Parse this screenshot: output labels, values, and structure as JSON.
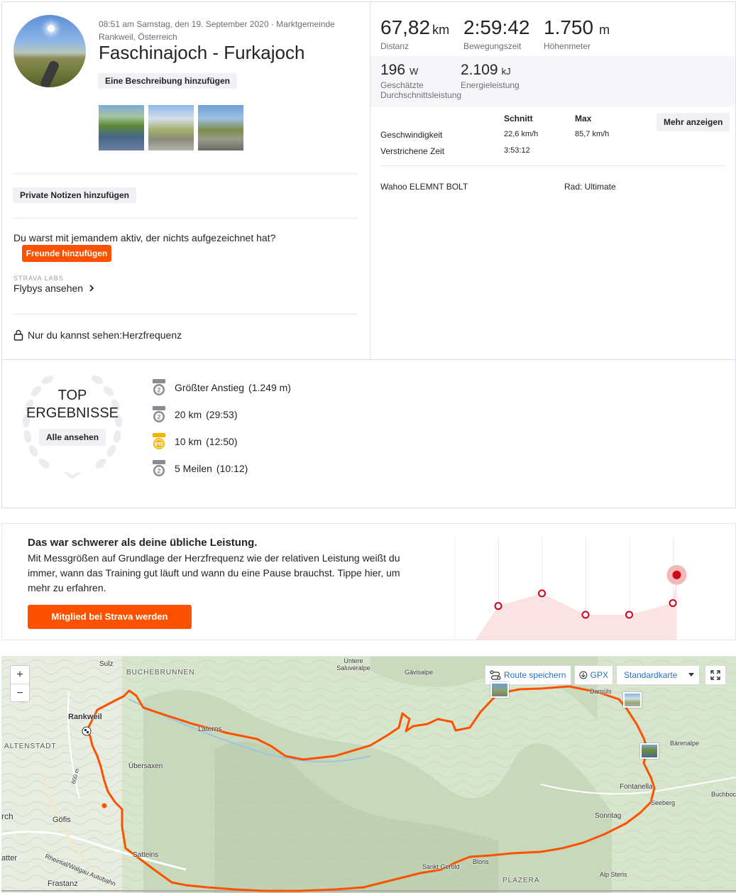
{
  "activity": {
    "meta": "08:51 am Samstag, den 19. September 2020 · Marktgemeinde Rankweil, Österreich",
    "title": "Faschinajoch - Furkajoch",
    "add_description": "Eine Beschreibung hinzufügen",
    "private_notes": "Private Notizen hinzufügen",
    "question": "Du warst mit jemandem aktiv, der nichts aufgezeichnet hat?",
    "add_friends": "Freunde hinzufügen",
    "labs_label": "STRAVA LABS",
    "flybys": "Flybys ansehen",
    "privacy": "Nur du kannst sehen:Herzfrequenz"
  },
  "stats": {
    "distance": {
      "value": "67,82",
      "unit": "km",
      "label": "Distanz"
    },
    "moving_time": {
      "value": "2:59:42",
      "label": "Bewegungszeit"
    },
    "elevation": {
      "value": "1.750",
      "unit": "m",
      "label": "Höhenmeter"
    },
    "power": {
      "value": "196",
      "unit": "W",
      "label_1": "Geschätzte",
      "label_2": "Durchschnittsleistung"
    },
    "energy": {
      "value": "2.109",
      "unit": "kJ",
      "label": "Energieleistung"
    },
    "table": {
      "col_avg": "Schnitt",
      "col_max": "Max",
      "more_button": "Mehr anzeigen",
      "rows": [
        {
          "label": "Geschwindigkeit",
          "avg": "22,6 km/h",
          "max": "85,7 km/h"
        },
        {
          "label": "Verstrichene Zeit",
          "avg": "3:53:12",
          "max": ""
        }
      ]
    },
    "device": "Wahoo ELEMNT BOLT",
    "bike": "Rad: Ultimate"
  },
  "achievements": {
    "heading_1": "TOP",
    "heading_2": "ERGEBNISSE",
    "see_all": "Alle ansehen",
    "items": [
      {
        "label": "Größter Anstieg",
        "value": "(1.249 m)",
        "medal": "2",
        "color": "#8a8a92"
      },
      {
        "label": "20 km",
        "value": "(29:53)",
        "medal": "2",
        "color": "#8a8a92"
      },
      {
        "label": "10 km",
        "value": "(12:50)",
        "medal": "PR",
        "color": "#f5b400"
      },
      {
        "label": "5 Meilen",
        "value": "(10:12)",
        "medal": "2",
        "color": "#8a8a92"
      }
    ]
  },
  "promo": {
    "title": "Das war schwerer als deine übliche Leistung.",
    "text": "Mit Messgrößen auf Grundlage der Herzfrequenz wie der relativen Leistung weißt du immer, wann das Training gut läuft und wann du eine Pause brauchst. Tippe hier, um mehr zu erfahren.",
    "cta": "Mitglied bei Strava werden",
    "accent": "#fc5200",
    "chart_values": [
      0.36,
      0.49,
      0.27,
      0.27,
      0.39,
      0.68
    ]
  },
  "map": {
    "zoom_in": "+",
    "zoom_out": "−",
    "save_route": "Route speichern",
    "gpx": "GPX",
    "map_type": "Standardkarte",
    "route_color": "#fc5200",
    "places": {
      "sulz": "Sulz",
      "buchebrunnen": "BUCHEBRUNNEN",
      "untere_saluveralpe": "Untere Saluveralpe",
      "gavisalpe": "Gävisalpe",
      "rankweil": "Rankweil",
      "altenstadt": "ALTENSTADT",
      "laterns": "Laterns",
      "ubersaxen": "Übersaxen",
      "barenalpe": "Bärenalpe",
      "fontanella": "Fontanella",
      "buchboden": "Buchboc",
      "seeberg": "Seeberg",
      "goefis": "Göfis",
      "rch": "rch",
      "sonntag": "Sonntag",
      "satteins": "Satteins",
      "rheintal": "Rheintal/Walgau Autobahn",
      "atter": "atter",
      "sankt_gerold": "Sankt Gerold",
      "blons": "Blons",
      "alp_steris": "Alp Steris",
      "frastanz": "Frastanz",
      "plazera": "PLAZERA",
      "road_600m": "600 m",
      "damuls": "Damüls"
    }
  }
}
